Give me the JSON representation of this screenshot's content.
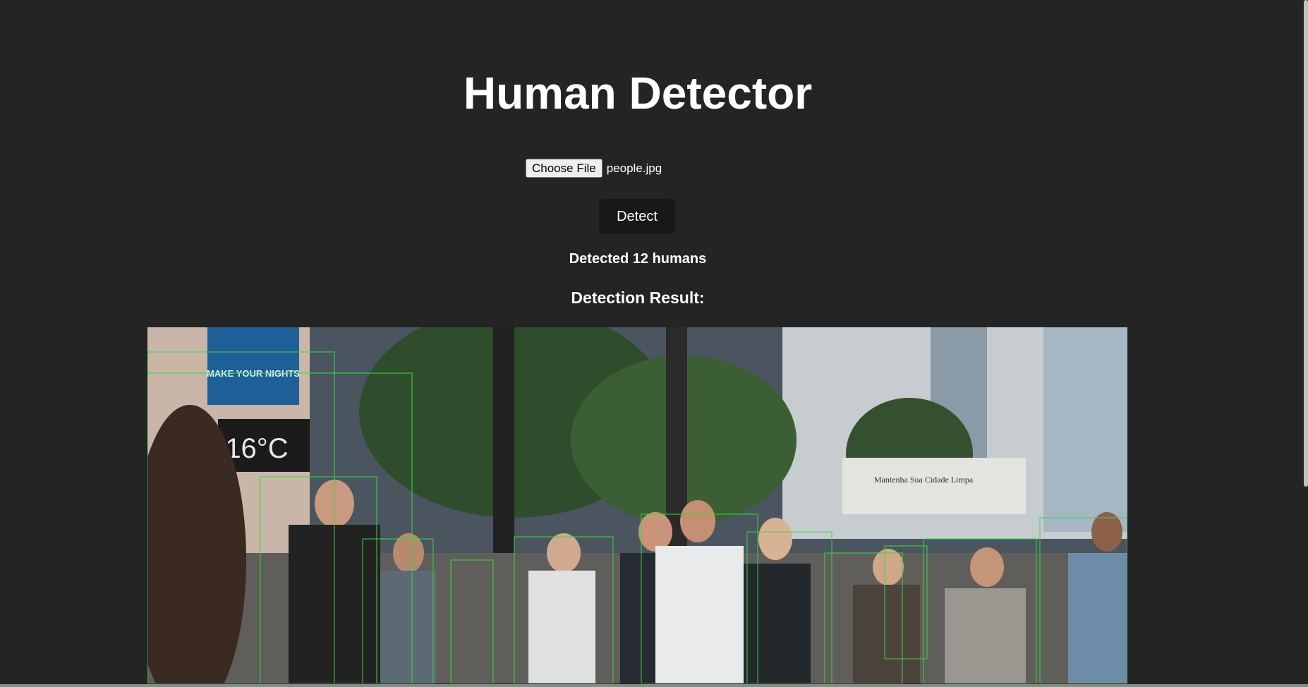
{
  "page": {
    "title": "Human Detector"
  },
  "upload": {
    "button_label": "Choose File",
    "file_name": "people.jpg"
  },
  "actions": {
    "detect_label": "Detect"
  },
  "result": {
    "count_text": "Detected 12 humans",
    "label": "Detection Result:",
    "image_alt": "Street crowd photo with green detection boxes",
    "image_overlay_text": [
      "MAKE YOUR NIGHTS",
      "16°C",
      "Mantenha Sua Cidade Limpa"
    ]
  },
  "colors": {
    "background": "#242424",
    "text": "#ffffff",
    "detect_button": "#181818",
    "box_stroke": "#3bd63b"
  }
}
